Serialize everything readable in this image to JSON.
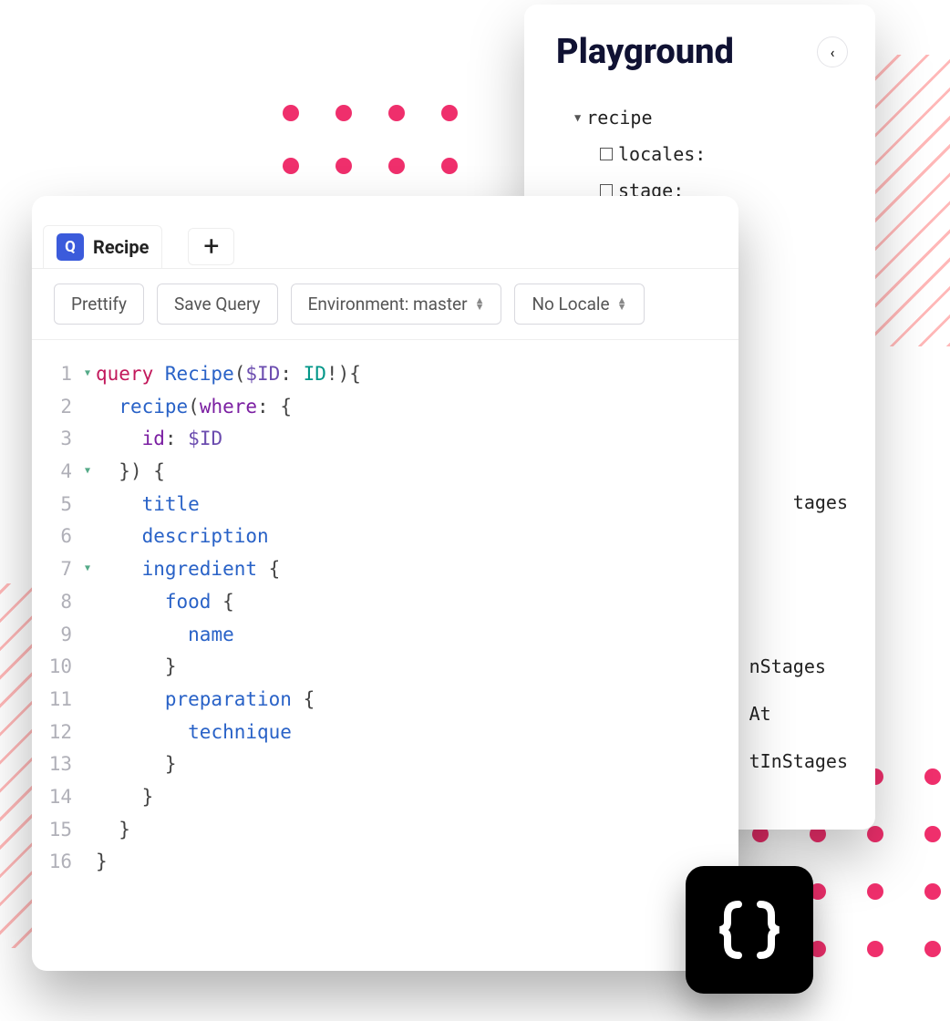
{
  "playground": {
    "title": "Playground",
    "tree": {
      "root": "recipe",
      "args": [
        "locales:",
        "stage:"
      ]
    },
    "peek_partial": [
      "tages",
      "nStages",
      "At",
      "tInStages"
    ]
  },
  "editor_panel": {
    "tab_badge": "Q",
    "tab_label": "Recipe",
    "toolbar": {
      "prettify": "Prettify",
      "save": "Save Query",
      "environment": "Environment: master",
      "locale": "No Locale"
    },
    "code": {
      "lines": [
        {
          "n": "1",
          "fold": true,
          "tokens": [
            [
              "kw",
              "query "
            ],
            [
              "field",
              "Recipe"
            ],
            [
              "punc",
              "("
            ],
            [
              "var",
              "$ID"
            ],
            [
              "punc",
              ": "
            ],
            [
              "type",
              "ID"
            ],
            [
              "punc",
              "!"
            ],
            [
              "punc",
              ")"
            ],
            [
              "punc",
              "{"
            ]
          ]
        },
        {
          "n": "2",
          "fold": false,
          "tokens": [
            [
              "punc",
              "  "
            ],
            [
              "attr",
              "recipe"
            ],
            [
              "punc",
              "("
            ],
            [
              "arg",
              "where"
            ],
            [
              "punc",
              ": "
            ],
            [
              "punc",
              "{"
            ]
          ]
        },
        {
          "n": "3",
          "fold": false,
          "tokens": [
            [
              "punc",
              "    "
            ],
            [
              "arg",
              "id"
            ],
            [
              "punc",
              ": "
            ],
            [
              "var",
              "$ID"
            ]
          ]
        },
        {
          "n": "4",
          "fold": true,
          "tokens": [
            [
              "punc",
              "  "
            ],
            [
              "punc",
              "}) {"
            ]
          ]
        },
        {
          "n": "5",
          "fold": false,
          "tokens": [
            [
              "punc",
              "    "
            ],
            [
              "attr",
              "title"
            ]
          ]
        },
        {
          "n": "6",
          "fold": false,
          "tokens": [
            [
              "punc",
              "    "
            ],
            [
              "attr",
              "description"
            ]
          ]
        },
        {
          "n": "7",
          "fold": true,
          "tokens": [
            [
              "punc",
              "    "
            ],
            [
              "attr",
              "ingredient"
            ],
            [
              "punc",
              " {"
            ]
          ]
        },
        {
          "n": "8",
          "fold": false,
          "tokens": [
            [
              "punc",
              "      "
            ],
            [
              "attr",
              "food"
            ],
            [
              "punc",
              " {"
            ]
          ]
        },
        {
          "n": "9",
          "fold": false,
          "tokens": [
            [
              "punc",
              "        "
            ],
            [
              "attr",
              "name"
            ]
          ]
        },
        {
          "n": "10",
          "fold": false,
          "tokens": [
            [
              "punc",
              "      "
            ],
            [
              "punc",
              "}"
            ]
          ]
        },
        {
          "n": "11",
          "fold": false,
          "tokens": [
            [
              "punc",
              "      "
            ],
            [
              "attr",
              "preparation"
            ],
            [
              "punc",
              " {"
            ]
          ]
        },
        {
          "n": "12",
          "fold": false,
          "tokens": [
            [
              "punc",
              "        "
            ],
            [
              "attr",
              "technique"
            ]
          ]
        },
        {
          "n": "13",
          "fold": false,
          "tokens": [
            [
              "punc",
              "      "
            ],
            [
              "punc",
              "}"
            ]
          ]
        },
        {
          "n": "14",
          "fold": false,
          "tokens": [
            [
              "punc",
              "    "
            ],
            [
              "punc",
              "}"
            ]
          ]
        },
        {
          "n": "15",
          "fold": false,
          "tokens": [
            [
              "punc",
              "  "
            ],
            [
              "punc",
              "}"
            ]
          ]
        },
        {
          "n": "16",
          "fold": false,
          "tokens": [
            [
              "punc",
              "}"
            ]
          ]
        }
      ]
    }
  }
}
